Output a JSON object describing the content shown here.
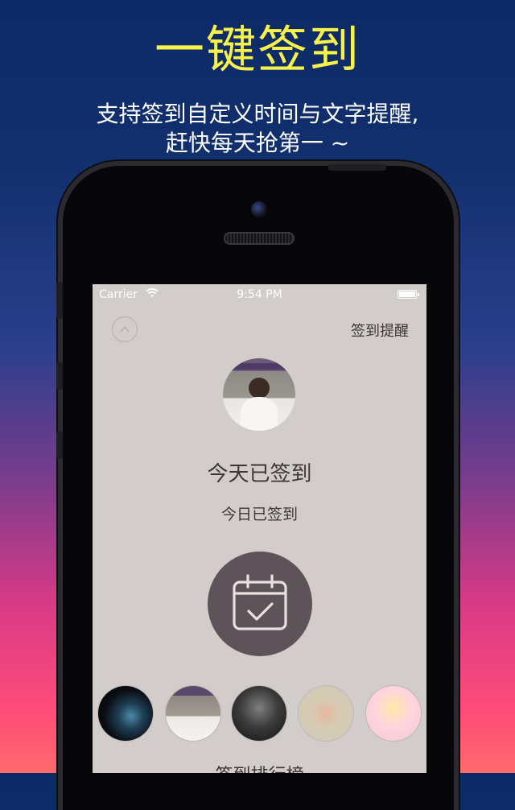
{
  "promo": {
    "headline": "一键签到",
    "subline_1": "支持签到自定义时间与文字提醒,",
    "subline_2": "赶快每天抢第一 ~"
  },
  "status_bar": {
    "carrier": "Carrier",
    "time": "9:54 PM"
  },
  "header": {
    "reminder_label": "签到提醒"
  },
  "checkin": {
    "status_title": "今天已签到",
    "status_subtitle": "今日已签到"
  },
  "ranking": {
    "title": "签到排行榜",
    "avatars": [
      "avatar-1",
      "avatar-2",
      "avatar-3",
      "avatar-4",
      "avatar-5"
    ]
  },
  "colors": {
    "headline": "#f7f24a",
    "screen_bg": "#d2ccca",
    "button_bg": "#5d5359"
  }
}
